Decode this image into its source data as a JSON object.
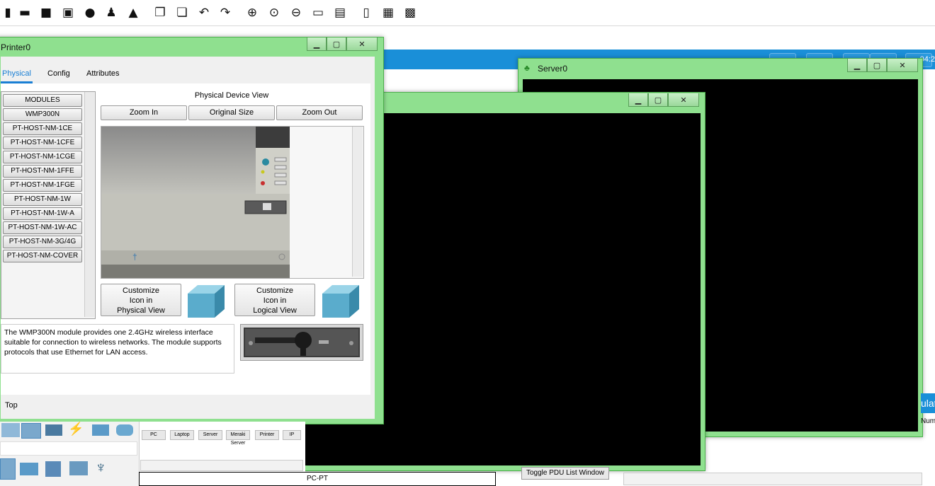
{
  "bluebar": {
    "time": "04:2"
  },
  "printer_window": {
    "title": "Printer0",
    "tabs": [
      "Physical",
      "Config",
      "Attributes"
    ],
    "physical_device_view_label": "Physical Device View",
    "zoom_in": "Zoom In",
    "original_size": "Original Size",
    "zoom_out": "Zoom Out",
    "modules": [
      "MODULES",
      "WMP300N",
      "PT-HOST-NM-1CE",
      "PT-HOST-NM-1CFE",
      "PT-HOST-NM-1CGE",
      "PT-HOST-NM-1FFE",
      "PT-HOST-NM-1FGE",
      "PT-HOST-NM-1W",
      "PT-HOST-NM-1W-A",
      "PT-HOST-NM-1W-AC",
      "PT-HOST-NM-3G/4G",
      "PT-HOST-NM-COVER"
    ],
    "customize_physical": [
      "Customize",
      "Icon in",
      "Physical View"
    ],
    "customize_logical": [
      "Customize",
      "Icon in",
      "Logical View"
    ],
    "description": "The WMP300N module provides one 2.4GHz wireless interface suitable for connection to wireless networks. The module supports protocols that use Ethernet for LAN access.",
    "top_label": "Top"
  },
  "server_window": {
    "title": "Server0"
  },
  "bottom": {
    "devices": [
      "PC",
      "Laptop",
      "Server",
      "Meraki Server",
      "Printer",
      "IP Phone"
    ],
    "selected_device": "PC-PT",
    "toggle_pdu": "Toggle PDU List Window",
    "right_partial": [
      "ulat",
      "Num"
    ]
  }
}
